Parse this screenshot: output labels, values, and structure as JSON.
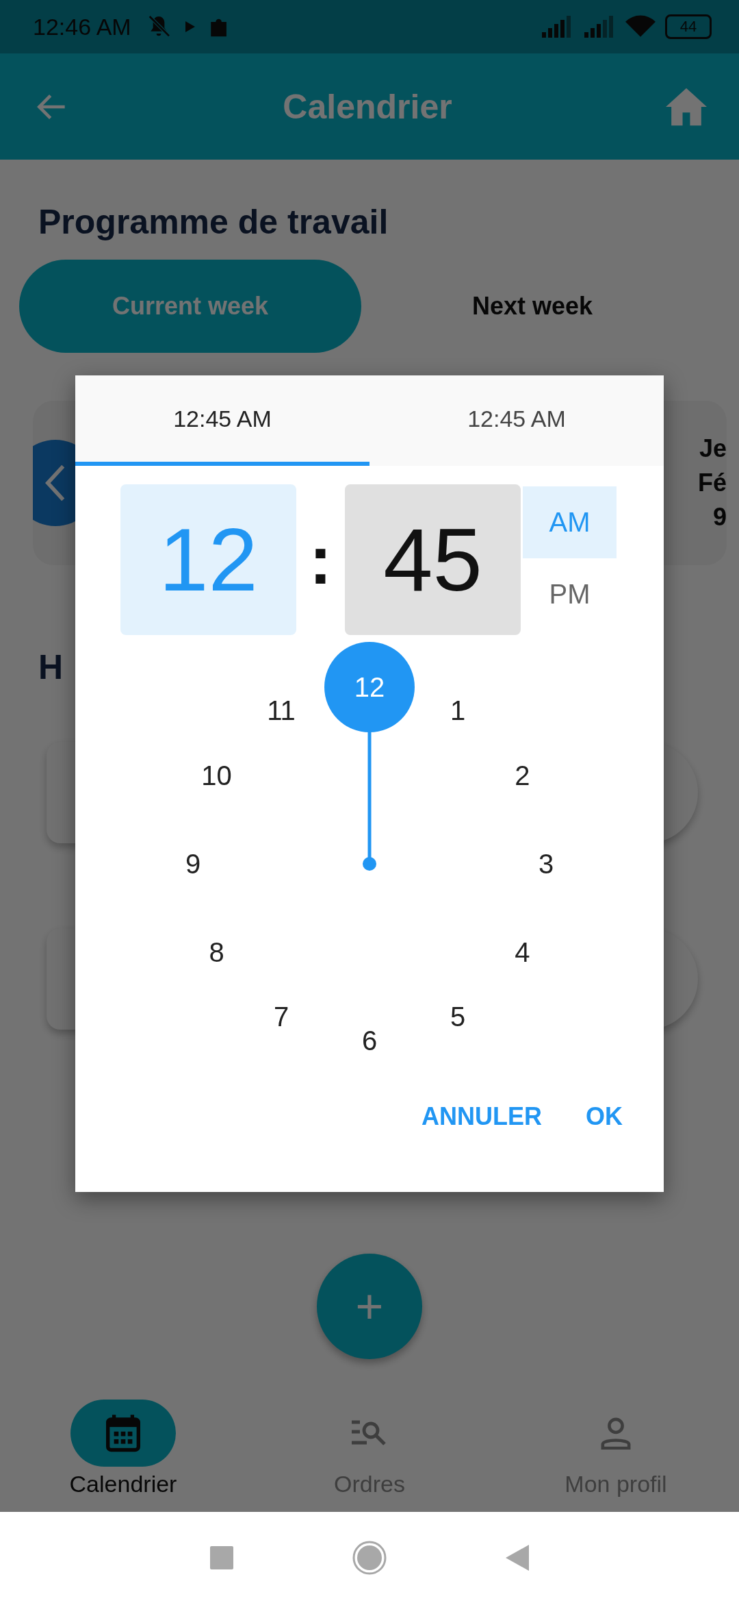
{
  "status_bar": {
    "time": "12:46 AM",
    "battery": "44"
  },
  "app_bar": {
    "title": "Calendrier"
  },
  "page": {
    "heading": "Programme de travail",
    "week_tabs": [
      {
        "label": "Current week",
        "selected": true
      },
      {
        "label": "Next week",
        "selected": false
      }
    ],
    "day_card": {
      "lines": [
        "Je",
        "Fé",
        "9"
      ]
    },
    "section_heading": "H"
  },
  "time_picker": {
    "tabs": [
      {
        "label": "12:45 AM",
        "selected": true
      },
      {
        "label": "12:45 AM",
        "selected": false
      }
    ],
    "hour": {
      "value": "12",
      "selected": true
    },
    "separator": ":",
    "minute": {
      "value": "45",
      "selected": false
    },
    "periods": [
      {
        "label": "AM",
        "selected": true
      },
      {
        "label": "PM",
        "selected": false
      }
    ],
    "dial": [
      {
        "label": "12",
        "selected": true
      },
      {
        "label": "1",
        "selected": false
      },
      {
        "label": "2",
        "selected": false
      },
      {
        "label": "3",
        "selected": false
      },
      {
        "label": "4",
        "selected": false
      },
      {
        "label": "5",
        "selected": false
      },
      {
        "label": "6",
        "selected": false
      },
      {
        "label": "7",
        "selected": false
      },
      {
        "label": "8",
        "selected": false
      },
      {
        "label": "9",
        "selected": false
      },
      {
        "label": "10",
        "selected": false
      },
      {
        "label": "11",
        "selected": false
      }
    ],
    "buttons": [
      "ANNULER",
      "OK"
    ]
  },
  "fab": {
    "label": "+"
  },
  "bottom_nav": [
    {
      "label": "Calendrier",
      "kind": "calendar",
      "selected": true
    },
    {
      "label": "Ordres",
      "kind": "orders",
      "selected": false
    },
    {
      "label": "Mon profil",
      "kind": "profile",
      "selected": false
    }
  ]
}
